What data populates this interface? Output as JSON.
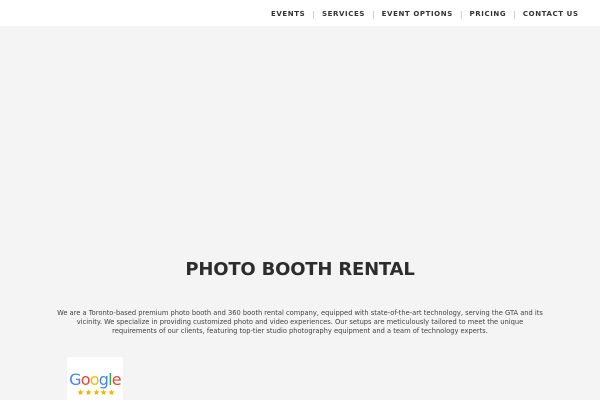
{
  "navigation": {
    "items": [
      {
        "label": "EVENTS"
      },
      {
        "label": "SERVICES"
      },
      {
        "label": "EVENT OPTIONS"
      },
      {
        "label": "PRICING"
      },
      {
        "label": "CONTACT US"
      }
    ],
    "separator": "|"
  },
  "content": {
    "title": "PHOTO BOOTH RENTAL",
    "description": "We are a Toronto-based premium photo booth and 360 booth rental company, equipped with state-of-the-art technology, serving the GTA and its vicinity. We specialize in providing customized photo and video experiences. Our setups are meticulously tailored to meet the unique requirements of our clients, featuring top-tier studio photography equipment and a team of technology experts."
  },
  "badge": {
    "logo_letters": [
      "G",
      "o",
      "o",
      "g",
      "l",
      "e"
    ],
    "rating_stars": 5,
    "logo_colors": {
      "blue": "#4285f4",
      "red": "#ea4335",
      "yellow": "#fbbc05",
      "green": "#34a853"
    },
    "star_color": "#f4b400",
    "icon_name": "star-icon"
  },
  "theme": {
    "page_background": "#f4f4f4",
    "nav_background": "#ffffff",
    "text_color": "#333333",
    "separator_color": "#b8b8b8"
  }
}
